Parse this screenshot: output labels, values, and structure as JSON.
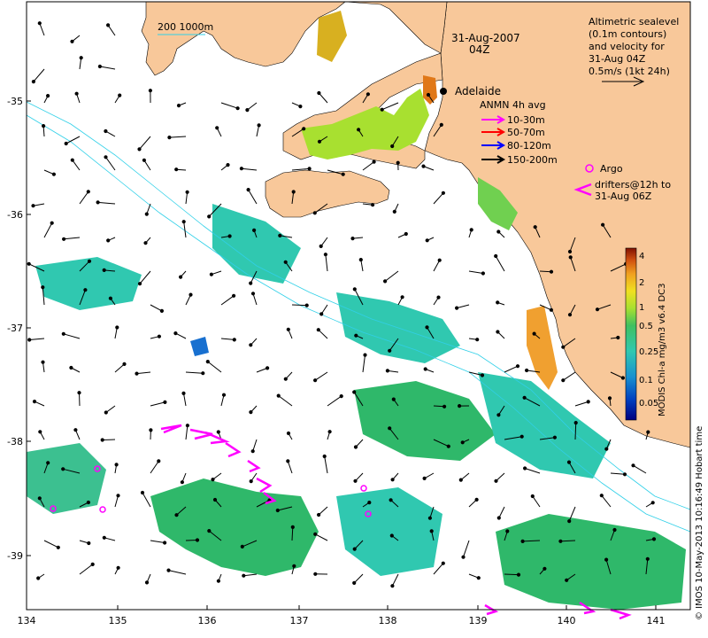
{
  "map": {
    "date_label": "31-Aug-2007",
    "time_label": "04Z",
    "city": "Adelaide",
    "scale_bar_label": "200  1000m",
    "altimetry_note": [
      "Altimetric sealevel",
      "(0.1m contours)",
      "and velocity for",
      "31-Aug 04Z",
      "0.5m/s (1kt 24h)"
    ],
    "anmn_title": "ANMN 4h avg",
    "anmn_legend": [
      {
        "label": "10-30m",
        "color": "#ff00ff"
      },
      {
        "label": "50-70m",
        "color": "#ff0000"
      },
      {
        "label": "80-120m",
        "color": "#0000ff"
      },
      {
        "label": "150-200m",
        "color": "#000000"
      }
    ],
    "argo_label": "Argo",
    "drifter_label": [
      "drifters@12h to",
      "31-Aug 06Z"
    ],
    "colorbar": {
      "title": "MODIS Chl-a mg/m3 v6.4 DC3",
      "ticks": [
        "4",
        "2",
        "1",
        "0.5",
        "0.25",
        "0.1",
        "0.05"
      ]
    },
    "credit": "© IMOS 10-May-2013 10:16:49 Hobart time",
    "x_ticks": [
      "134",
      "135",
      "136",
      "137",
      "138",
      "139",
      "140",
      "141"
    ],
    "y_ticks": [
      "-35",
      "-36",
      "-37",
      "-38",
      "-39"
    ],
    "colors": {
      "land": "#f8c89a",
      "chl_green": "#2fb86a",
      "chl_teal": "#30c8b0",
      "chl_yellowgreen": "#a8e030",
      "chl_orange": "#e07818",
      "contour": "#30d0e8",
      "magenta": "#ff00ff"
    }
  }
}
